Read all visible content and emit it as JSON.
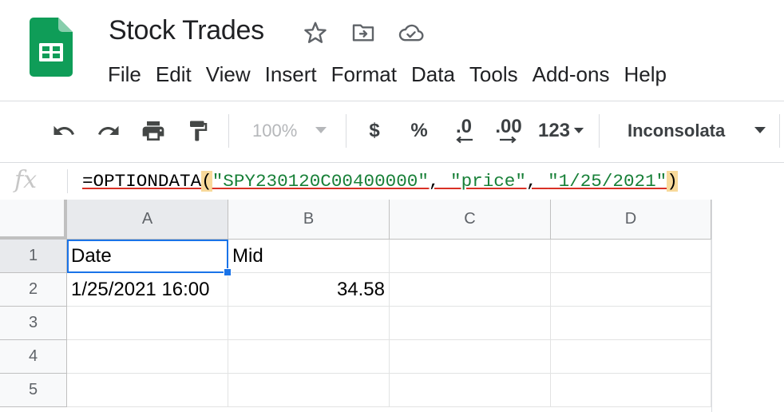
{
  "app": {
    "title": "Stock Trades",
    "title_icons": [
      "star-icon",
      "move-to-folder-icon",
      "cloud-saved-icon"
    ],
    "colors": {
      "logo_green": "#0f9d58",
      "selection_blue": "#1a73e8",
      "string_green": "#188038",
      "error_red": "#d93025"
    }
  },
  "menu": [
    "File",
    "Edit",
    "View",
    "Insert",
    "Format",
    "Data",
    "Tools",
    "Add-ons",
    "Help"
  ],
  "toolbar": {
    "zoom": "100%",
    "currency": "$",
    "percent": "%",
    "decrease_decimal": ".0",
    "increase_decimal": ".00",
    "number_format": "123",
    "font": "Inconsolata",
    "icons": [
      "undo-icon",
      "redo-icon",
      "print-icon",
      "paint-format-icon"
    ]
  },
  "formula_bar": {
    "fx_label": "fx",
    "formula": "=OPTIONDATA(\"SPY230120C00400000\", \"price\", \"1/25/2021\")",
    "parts": {
      "fn": "=OPTIONDATA",
      "open": "(",
      "arg1": "\"SPY230120C00400000\"",
      "sep1": ", ",
      "arg2": "\"price\"",
      "sep2": ", ",
      "arg3": "\"1/25/2021\"",
      "close": ")"
    }
  },
  "sheet": {
    "columns": [
      "A",
      "B",
      "C",
      "D"
    ],
    "rows": [
      "1",
      "2",
      "3",
      "4",
      "5"
    ],
    "cells": {
      "A1": "Date",
      "B1": "Mid",
      "A2": "1/25/2021 16:00",
      "B2": "34.58"
    },
    "selected_cell": "A1"
  }
}
